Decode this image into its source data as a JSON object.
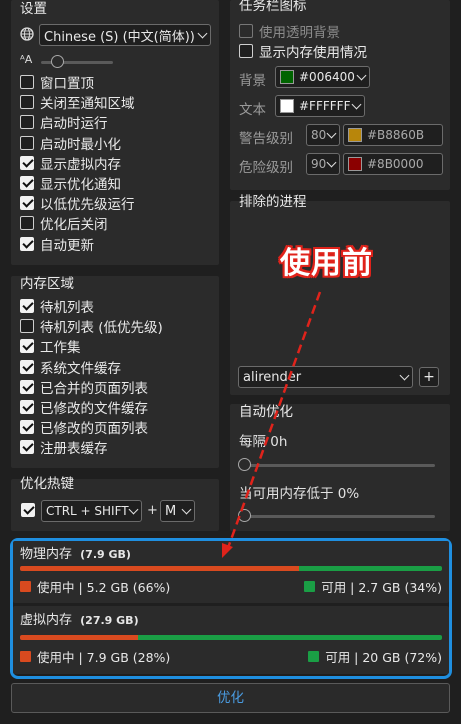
{
  "settings": {
    "title": "设置",
    "language": "Chinese (S) (中文(简体))",
    "font_size_icon": "ᴬA",
    "font_slider_level": 0.2,
    "options": [
      {
        "label": "窗口置顶",
        "checked": false
      },
      {
        "label": "关闭至通知区域",
        "checked": false
      },
      {
        "label": "启动时运行",
        "checked": false
      },
      {
        "label": "启动时最小化",
        "checked": false
      },
      {
        "label": "显示虚拟内存",
        "checked": true
      },
      {
        "label": "显示优化通知",
        "checked": true
      },
      {
        "label": "以低优先级运行",
        "checked": true
      },
      {
        "label": "优化后关闭",
        "checked": false
      },
      {
        "label": "自动更新",
        "checked": true
      }
    ]
  },
  "memory_areas": {
    "title": "内存区域",
    "options": [
      {
        "label": "待机列表",
        "checked": true
      },
      {
        "label": "待机列表 (低优先级)",
        "checked": false
      },
      {
        "label": "工作集",
        "checked": true
      },
      {
        "label": "系统文件缓存",
        "checked": true
      },
      {
        "label": "已合并的页面列表",
        "checked": true
      },
      {
        "label": "已修改的文件缓存",
        "checked": true
      },
      {
        "label": "已修改的页面列表",
        "checked": true
      },
      {
        "label": "注册表缓存",
        "checked": true
      }
    ]
  },
  "hotkey": {
    "title": "优化热键",
    "enabled": true,
    "modifier": "CTRL + SHIFT",
    "plus": "+",
    "key": "M"
  },
  "tray_icon": {
    "title": "任务栏图标",
    "options": [
      {
        "label": "使用透明背景",
        "checked": false,
        "disabled": true
      },
      {
        "label": "显示内存使用情况",
        "checked": false,
        "disabled": false
      }
    ],
    "background_label": "背景",
    "background_color": "#006400",
    "text_label": "文本",
    "text_color": "#FFFFFF",
    "warning_label": "警告级别",
    "warning_value": "80",
    "warning_color": "#B8860B",
    "danger_label": "危险级别",
    "danger_value": "90",
    "danger_color": "#8B0000"
  },
  "excluded_processes": {
    "title": "排除的进程",
    "process": "alirender",
    "add_label": "+"
  },
  "auto_optimize": {
    "title": "自动优化",
    "interval_label": "每隔 0h",
    "interval_level": 0,
    "threshold_label": "当可用内存低于 0%",
    "threshold_level": 0
  },
  "annotation": {
    "text": "使用前",
    "color": "#e0231b"
  },
  "physical_memory": {
    "title": "物理内存",
    "total": "(7.9 GB)",
    "used_fraction": 0.66,
    "used_label": "使用中 | 5.2 GB (66%)",
    "free_label": "可用 | 2.7 GB (34%)"
  },
  "virtual_memory": {
    "title": "虚拟内存",
    "total": "(27.9 GB)",
    "used_fraction": 0.28,
    "used_label": "使用中 | 7.9 GB (28%)",
    "free_label": "可用 | 20 GB (72%)"
  },
  "colors": {
    "used": "#d94a1f",
    "free": "#1a9e45",
    "highlight": "#1f8fe0"
  },
  "optimize_button": "优化"
}
